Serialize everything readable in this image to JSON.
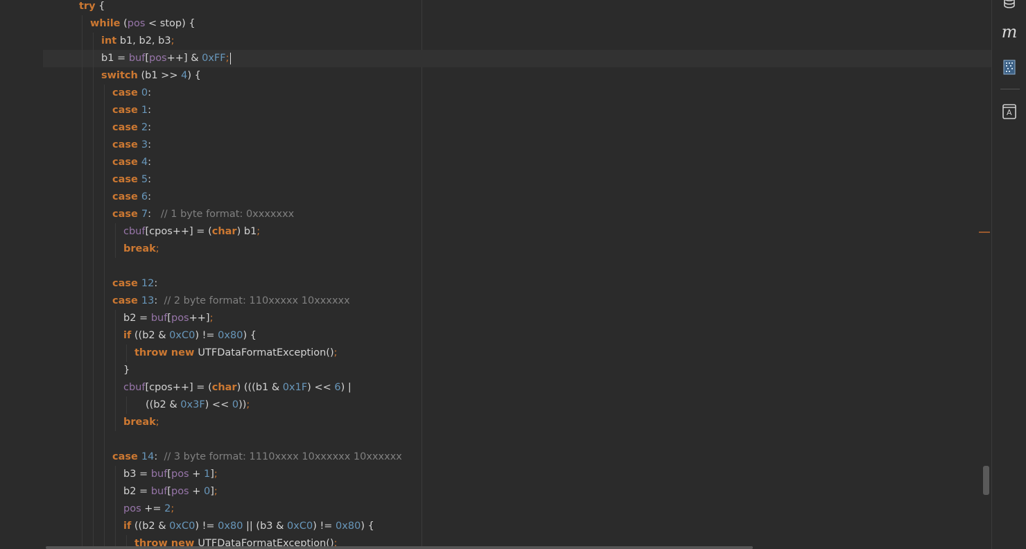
{
  "editor": {
    "lines": [
      {
        "indent": 0,
        "tokens": [
          [
            "kw",
            "try"
          ],
          [
            "txt",
            " {"
          ]
        ]
      },
      {
        "indent": 1,
        "tokens": [
          [
            "kw",
            "while"
          ],
          [
            "txt",
            " ("
          ],
          [
            "fld",
            "pos"
          ],
          [
            "txt",
            " < stop) {"
          ]
        ]
      },
      {
        "indent": 2,
        "tokens": [
          [
            "kw",
            "int"
          ],
          [
            "txt",
            " b1, b2, b3"
          ],
          [
            "pun",
            ";"
          ]
        ]
      },
      {
        "indent": 2,
        "current": true,
        "caret": true,
        "tokens": [
          [
            "txt",
            "b1 = "
          ],
          [
            "fld",
            "buf"
          ],
          [
            "txt",
            "["
          ],
          [
            "fld",
            "pos"
          ],
          [
            "txt",
            "++] & "
          ],
          [
            "num",
            "0xFF"
          ],
          [
            "pun",
            ";"
          ]
        ]
      },
      {
        "indent": 2,
        "tokens": [
          [
            "kw",
            "switch"
          ],
          [
            "txt",
            " (b1 >> "
          ],
          [
            "num",
            "4"
          ],
          [
            "txt",
            ") {"
          ]
        ]
      },
      {
        "indent": 3,
        "tokens": [
          [
            "kw",
            "case "
          ],
          [
            "num",
            "0"
          ],
          [
            "txt",
            ":"
          ]
        ]
      },
      {
        "indent": 3,
        "tokens": [
          [
            "kw",
            "case "
          ],
          [
            "num",
            "1"
          ],
          [
            "txt",
            ":"
          ]
        ]
      },
      {
        "indent": 3,
        "tokens": [
          [
            "kw",
            "case "
          ],
          [
            "num",
            "2"
          ],
          [
            "txt",
            ":"
          ]
        ]
      },
      {
        "indent": 3,
        "tokens": [
          [
            "kw",
            "case "
          ],
          [
            "num",
            "3"
          ],
          [
            "txt",
            ":"
          ]
        ]
      },
      {
        "indent": 3,
        "tokens": [
          [
            "kw",
            "case "
          ],
          [
            "num",
            "4"
          ],
          [
            "txt",
            ":"
          ]
        ]
      },
      {
        "indent": 3,
        "tokens": [
          [
            "kw",
            "case "
          ],
          [
            "num",
            "5"
          ],
          [
            "txt",
            ":"
          ]
        ]
      },
      {
        "indent": 3,
        "tokens": [
          [
            "kw",
            "case "
          ],
          [
            "num",
            "6"
          ],
          [
            "txt",
            ":"
          ]
        ]
      },
      {
        "indent": 3,
        "tokens": [
          [
            "kw",
            "case "
          ],
          [
            "num",
            "7"
          ],
          [
            "txt",
            ":   "
          ],
          [
            "cmt",
            "// 1 byte format: 0xxxxxxx"
          ]
        ]
      },
      {
        "indent": 4,
        "tokens": [
          [
            "fld",
            "cbuf"
          ],
          [
            "txt",
            "[cpos++] = ("
          ],
          [
            "kw",
            "char"
          ],
          [
            "txt",
            ") b1"
          ],
          [
            "pun",
            ";"
          ]
        ]
      },
      {
        "indent": 4,
        "tokens": [
          [
            "kw",
            "break"
          ],
          [
            "pun",
            ";"
          ]
        ]
      },
      {
        "indent": 0,
        "tokens": []
      },
      {
        "indent": 3,
        "tokens": [
          [
            "kw",
            "case "
          ],
          [
            "num",
            "12"
          ],
          [
            "txt",
            ":"
          ]
        ]
      },
      {
        "indent": 3,
        "tokens": [
          [
            "kw",
            "case "
          ],
          [
            "num",
            "13"
          ],
          [
            "txt",
            ":  "
          ],
          [
            "cmt",
            "// 2 byte format: 110xxxxx 10xxxxxx"
          ]
        ]
      },
      {
        "indent": 4,
        "tokens": [
          [
            "txt",
            "b2 = "
          ],
          [
            "fld",
            "buf"
          ],
          [
            "txt",
            "["
          ],
          [
            "fld",
            "pos"
          ],
          [
            "txt",
            "++]"
          ],
          [
            "pun",
            ";"
          ]
        ]
      },
      {
        "indent": 4,
        "tokens": [
          [
            "kw",
            "if"
          ],
          [
            "txt",
            " ((b2 & "
          ],
          [
            "num",
            "0xC0"
          ],
          [
            "txt",
            ") != "
          ],
          [
            "num",
            "0x80"
          ],
          [
            "txt",
            ") {"
          ]
        ]
      },
      {
        "indent": 5,
        "tokens": [
          [
            "kw",
            "throw new "
          ],
          [
            "txt",
            "UTFDataFormatException()"
          ],
          [
            "pun",
            ";"
          ]
        ]
      },
      {
        "indent": 4,
        "tokens": [
          [
            "txt",
            "}"
          ]
        ]
      },
      {
        "indent": 4,
        "tokens": [
          [
            "fld",
            "cbuf"
          ],
          [
            "txt",
            "[cpos++] = ("
          ],
          [
            "kw",
            "char"
          ],
          [
            "txt",
            ") (((b1 & "
          ],
          [
            "num",
            "0x1F"
          ],
          [
            "txt",
            ") << "
          ],
          [
            "num",
            "6"
          ],
          [
            "txt",
            ") |"
          ]
        ]
      },
      {
        "indent": 6,
        "tokens": [
          [
            "txt",
            "((b2 & "
          ],
          [
            "num",
            "0x3F"
          ],
          [
            "txt",
            ") << "
          ],
          [
            "num",
            "0"
          ],
          [
            "txt",
            "))"
          ],
          [
            "pun",
            ";"
          ]
        ]
      },
      {
        "indent": 4,
        "tokens": [
          [
            "kw",
            "break"
          ],
          [
            "pun",
            ";"
          ]
        ]
      },
      {
        "indent": 0,
        "tokens": []
      },
      {
        "indent": 3,
        "tokens": [
          [
            "kw",
            "case "
          ],
          [
            "num",
            "14"
          ],
          [
            "txt",
            ":  "
          ],
          [
            "cmt",
            "// 3 byte format: 1110xxxx 10xxxxxx 10xxxxxx"
          ]
        ]
      },
      {
        "indent": 4,
        "tokens": [
          [
            "txt",
            "b3 = "
          ],
          [
            "fld",
            "buf"
          ],
          [
            "txt",
            "["
          ],
          [
            "fld",
            "pos"
          ],
          [
            "txt",
            " + "
          ],
          [
            "num",
            "1"
          ],
          [
            "txt",
            "]"
          ],
          [
            "pun",
            ";"
          ]
        ]
      },
      {
        "indent": 4,
        "tokens": [
          [
            "txt",
            "b2 = "
          ],
          [
            "fld",
            "buf"
          ],
          [
            "txt",
            "["
          ],
          [
            "fld",
            "pos"
          ],
          [
            "txt",
            " + "
          ],
          [
            "num",
            "0"
          ],
          [
            "txt",
            "]"
          ],
          [
            "pun",
            ";"
          ]
        ]
      },
      {
        "indent": 4,
        "tokens": [
          [
            "fld",
            "pos"
          ],
          [
            "txt",
            " += "
          ],
          [
            "num",
            "2"
          ],
          [
            "pun",
            ";"
          ]
        ]
      },
      {
        "indent": 4,
        "tokens": [
          [
            "kw",
            "if"
          ],
          [
            "txt",
            " ((b2 & "
          ],
          [
            "num",
            "0xC0"
          ],
          [
            "txt",
            ") != "
          ],
          [
            "num",
            "0x80"
          ],
          [
            "txt",
            " || (b3 & "
          ],
          [
            "num",
            "0xC0"
          ],
          [
            "txt",
            ") != "
          ],
          [
            "num",
            "0x80"
          ],
          [
            "txt",
            ") {"
          ]
        ]
      },
      {
        "indent": 5,
        "tokens": [
          [
            "kw",
            "throw new "
          ],
          [
            "txt",
            "UTFDataFormatException()"
          ],
          [
            "pun",
            ";"
          ]
        ]
      }
    ]
  },
  "right_toolbar": {
    "icons": [
      "database-icon",
      "maven-icon",
      "binary-file-icon",
      "dictionary-icon"
    ],
    "maven_glyph": "m",
    "dictionary_glyph": "A"
  },
  "colors": {
    "background": "#2b2b2b",
    "keyword": "#cc7832",
    "number": "#6897bb",
    "field": "#9876aa",
    "comment": "#808080",
    "text": "#d4d4d4"
  }
}
